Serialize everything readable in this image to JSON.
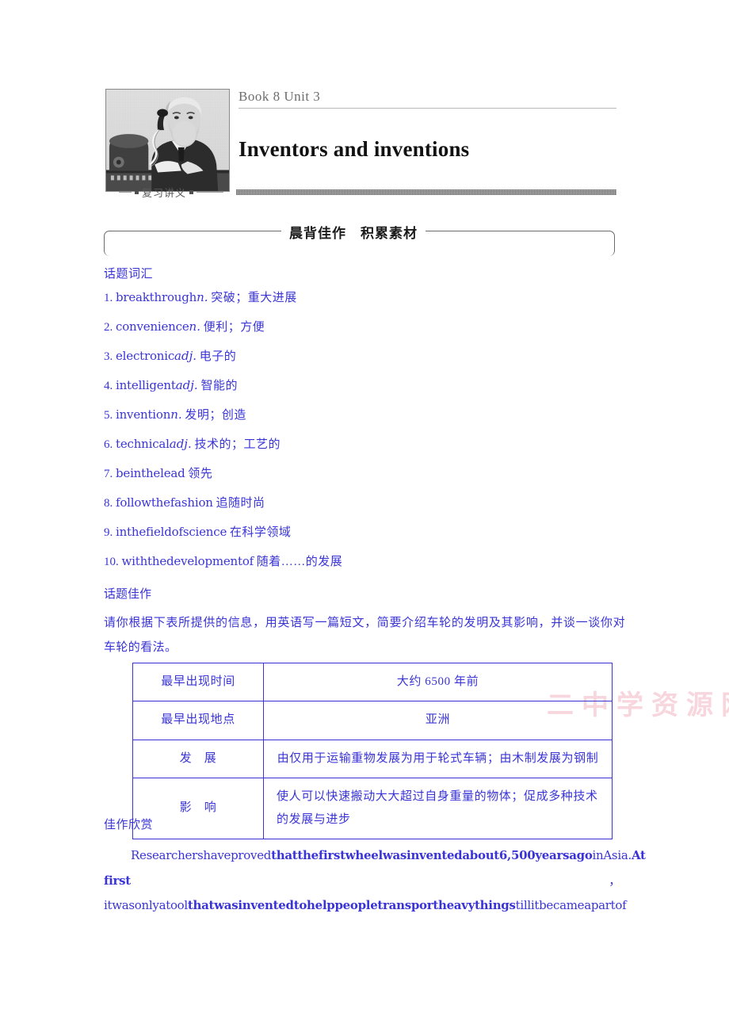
{
  "header": {
    "unit_line": "Book 8  Unit 3",
    "main_title": "Inventors and inventions",
    "tag_label": "复习讲义",
    "portrait_alt": "inventor-portrait"
  },
  "section": {
    "title": "晨背佳作　积累素材"
  },
  "vocab": {
    "heading": "话题词汇",
    "items": [
      {
        "num": "1.",
        "word": "breakthrough",
        "pos": "n.",
        "def": "突破；重大进展"
      },
      {
        "num": "2.",
        "word": "convenience",
        "pos": "n.",
        "def": "便利；方便"
      },
      {
        "num": "3.",
        "word": "electronic",
        "pos": "adj.",
        "def": "电子的"
      },
      {
        "num": "4.",
        "word": "intelligent",
        "pos": "adj.",
        "def": "智能的"
      },
      {
        "num": "5.",
        "word": "invention",
        "pos": "n.",
        "def": "发明；创造"
      },
      {
        "num": "6.",
        "word": "technical",
        "pos": "adj.",
        "def": "技术的；工艺的"
      },
      {
        "num": "7.",
        "word": "beinthelead",
        "pos": "",
        "def": "领先"
      },
      {
        "num": "8.",
        "word": "followthefashion",
        "pos": "",
        "def": "追随时尚"
      },
      {
        "num": "9.",
        "word": "inthefieldofscience",
        "pos": "",
        "def": "在科学领域"
      },
      {
        "num": "10.",
        "word": "withthedevelopmentof",
        "pos": "",
        "def": "随着……的发展"
      }
    ]
  },
  "prompt": {
    "heading": "话题佳作",
    "body": "请你根据下表所提供的信息，用英语写一篇短文，简要介绍车轮的发明及其影响，并谈一谈你对车轮的看法。"
  },
  "table": {
    "rows": [
      {
        "label": "最早出现时间",
        "value": "大约 6500 年前",
        "wrap": false
      },
      {
        "label": "最早出现地点",
        "value": "亚洲",
        "wrap": false
      },
      {
        "label": "发　展",
        "value": "由仅用于运输重物发展为用于轮式车辆；由木制发展为钢制",
        "wrap": false
      },
      {
        "label": "影　响",
        "value": "使人可以快速搬动大大超过自身重量的物体；促成多种技术的发展与进步",
        "wrap": true
      }
    ]
  },
  "essay": {
    "heading": "佳作欣赏",
    "line1_regular_a": "Researchershaveproved",
    "line1_bold": "thatthefirstwheelwasinventedabout6,500yearsago",
    "line1_regular_b": "inAsia.",
    "line1_tail_bold": "At",
    "line2_left_bold": "first",
    "line2_right": "，",
    "line3_regular_a": "itwasonlyatool",
    "line3_bold": "thatwasinventedtohelppeopletransportheavythings",
    "line3_regular_b": "tillitbecameapartof"
  },
  "watermark": {
    "text": "二中学资源网"
  },
  "colors": {
    "body_blue": "#3a34d6",
    "title_black": "#111111",
    "unit_gray": "#6d6d6d",
    "watermark_pink": "#f7cfd8"
  }
}
